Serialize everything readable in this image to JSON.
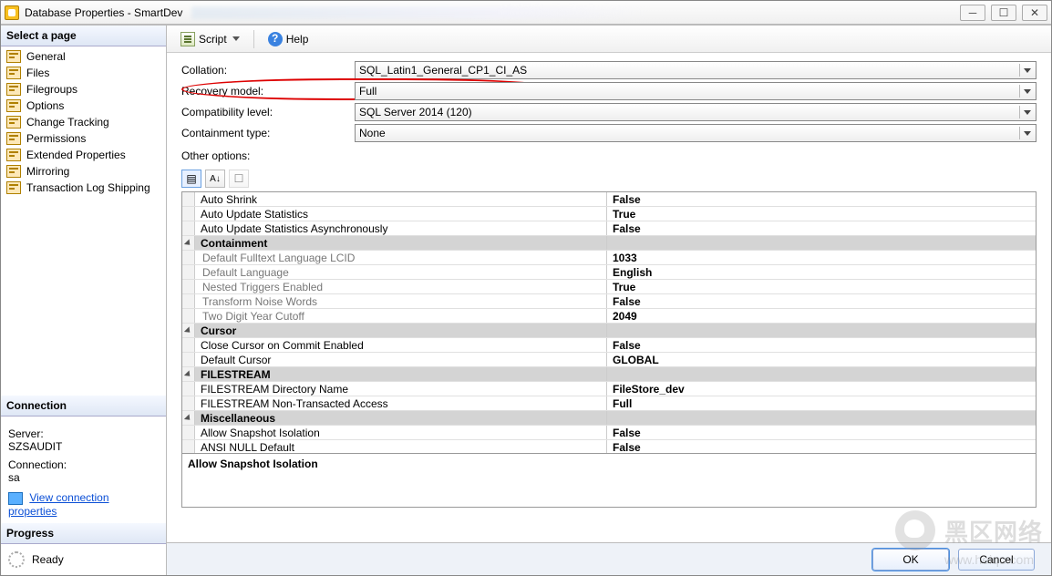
{
  "window": {
    "title": "Database Properties - SmartDev"
  },
  "winbtns": {
    "min": "─",
    "max": "☐",
    "close": "✕"
  },
  "left": {
    "select_page": "Select a page",
    "pages": [
      "General",
      "Files",
      "Filegroups",
      "Options",
      "Change Tracking",
      "Permissions",
      "Extended Properties",
      "Mirroring",
      "Transaction Log Shipping"
    ],
    "connection_head": "Connection",
    "server_label": "Server:",
    "server_value": "SZSAUDIT",
    "connection_label": "Connection:",
    "connection_value": "sa",
    "view_conn": "View connection properties",
    "progress_head": "Progress",
    "progress_value": "Ready"
  },
  "toolbar": {
    "script": "Script",
    "help": "Help"
  },
  "form": {
    "collation_label": "Collation:",
    "collation_value": "SQL_Latin1_General_CP1_CI_AS",
    "recovery_label": "Recovery model:",
    "recovery_value": "Full",
    "compat_label": "Compatibility level:",
    "compat_value": "SQL Server 2014 (120)",
    "contain_label": "Containment type:",
    "contain_value": "None",
    "other_options": "Other options:"
  },
  "grid": {
    "rows": [
      {
        "type": "prop",
        "name": "Auto Shrink",
        "value": "False"
      },
      {
        "type": "prop",
        "name": "Auto Update Statistics",
        "value": "True"
      },
      {
        "type": "prop",
        "name": "Auto Update Statistics Asynchronously",
        "value": "False"
      },
      {
        "type": "cat",
        "name": "Containment"
      },
      {
        "type": "child",
        "name": "Default Fulltext Language LCID",
        "value": "1033"
      },
      {
        "type": "child",
        "name": "Default Language",
        "value": "English"
      },
      {
        "type": "child",
        "name": "Nested Triggers Enabled",
        "value": "True"
      },
      {
        "type": "child",
        "name": "Transform Noise Words",
        "value": "False"
      },
      {
        "type": "child",
        "name": "Two Digit Year Cutoff",
        "value": "2049"
      },
      {
        "type": "cat",
        "name": "Cursor"
      },
      {
        "type": "prop",
        "name": "Close Cursor on Commit Enabled",
        "value": "False"
      },
      {
        "type": "prop",
        "name": "Default Cursor",
        "value": "GLOBAL"
      },
      {
        "type": "cat",
        "name": "FILESTREAM"
      },
      {
        "type": "prop",
        "name": "FILESTREAM Directory Name",
        "value": "FileStore_dev"
      },
      {
        "type": "prop",
        "name": "FILESTREAM Non-Transacted Access",
        "value": "Full"
      },
      {
        "type": "cat",
        "name": "Miscellaneous"
      },
      {
        "type": "prop",
        "name": "Allow Snapshot Isolation",
        "value": "False"
      },
      {
        "type": "prop",
        "name": "ANSI NULL Default",
        "value": "False"
      }
    ],
    "desc_title": "Allow Snapshot Isolation"
  },
  "buttons": {
    "ok": "OK",
    "cancel": "Cancel"
  },
  "watermark": {
    "text": "黑区网络",
    "sub": "www.heiqu.com"
  }
}
